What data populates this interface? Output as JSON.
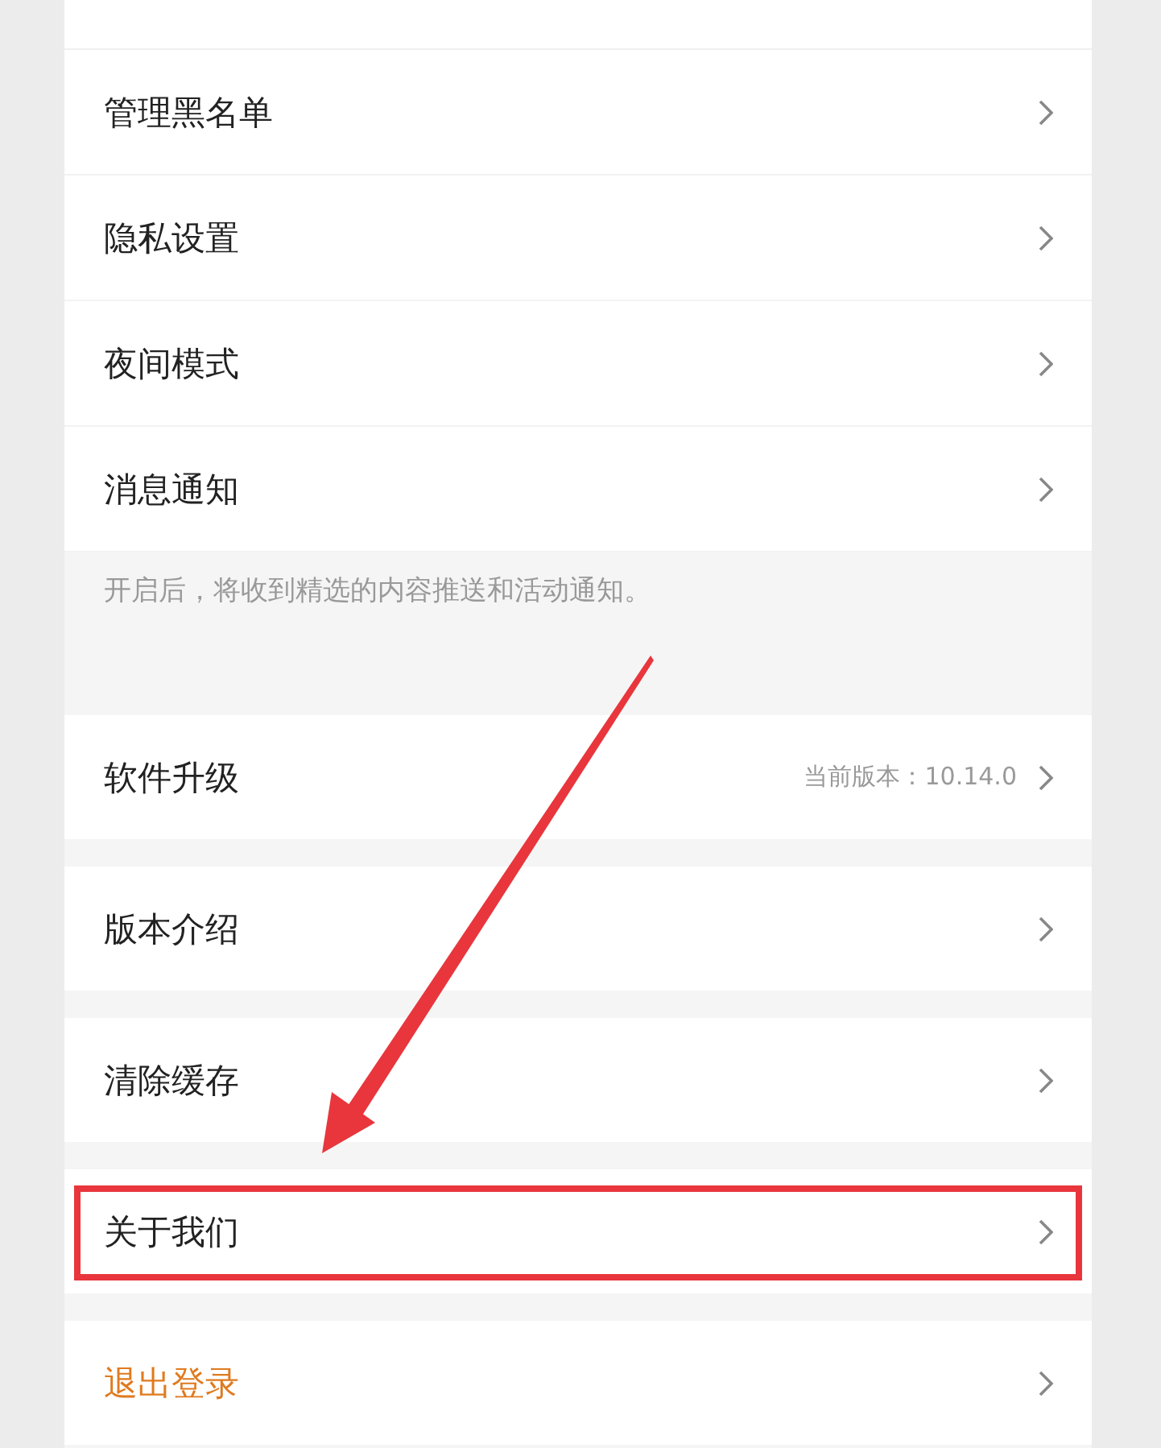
{
  "groups": [
    {
      "partial_top": true,
      "items": [
        {
          "label": "管理黑名单",
          "kind": "normal",
          "highlighted": false
        },
        {
          "label": "隐私设置",
          "kind": "normal",
          "highlighted": false
        },
        {
          "label": "夜间模式",
          "kind": "normal",
          "highlighted": false
        },
        {
          "label": "消息通知",
          "kind": "normal",
          "highlighted": false
        }
      ],
      "hint": "开启后，将收到精选的内容推送和活动通知。"
    },
    {
      "items": [
        {
          "label": "软件升级",
          "detail": "当前版本：10.14.0",
          "kind": "normal",
          "highlighted": false
        }
      ]
    },
    {
      "items": [
        {
          "label": "版本介绍",
          "kind": "normal",
          "highlighted": false
        }
      ]
    },
    {
      "items": [
        {
          "label": "清除缓存",
          "kind": "normal",
          "highlighted": false
        }
      ]
    },
    {
      "items": [
        {
          "label": "关于我们",
          "kind": "normal",
          "highlighted": true
        }
      ]
    },
    {
      "items": [
        {
          "label": "退出登录",
          "kind": "logout",
          "highlighted": false
        }
      ]
    }
  ]
}
